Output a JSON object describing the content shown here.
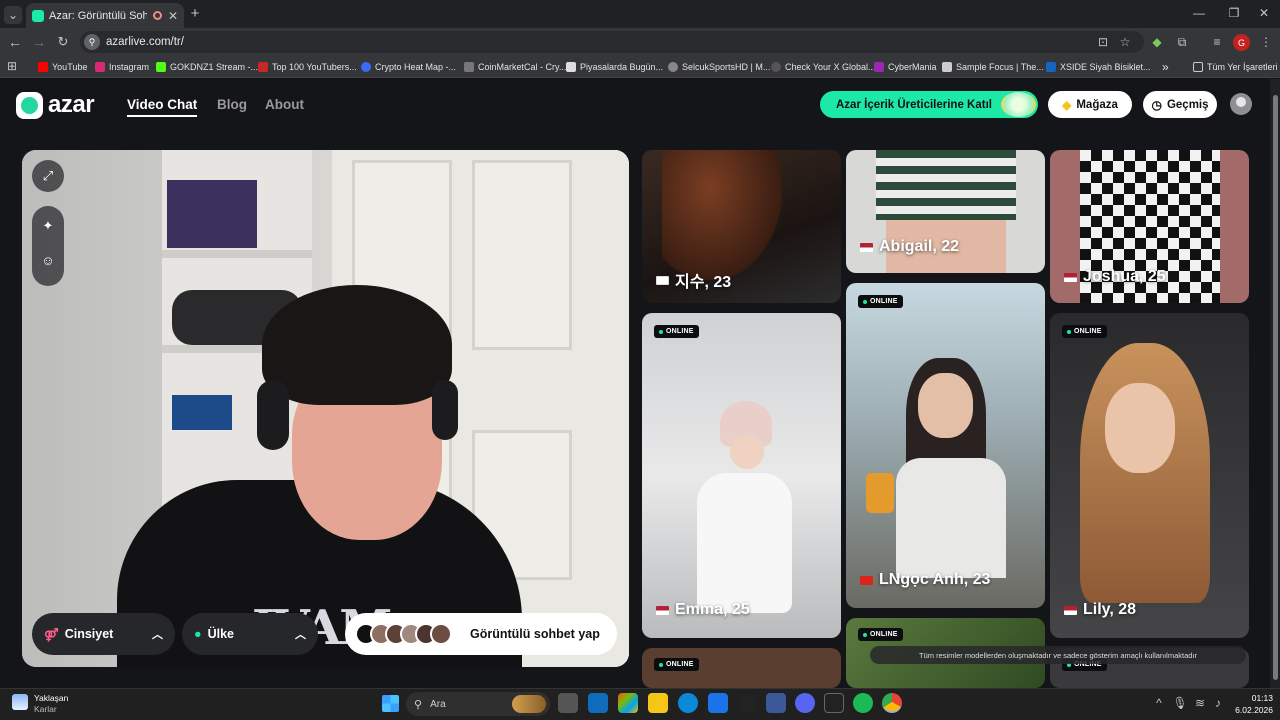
{
  "browser": {
    "tab_title": "Azar: Görüntülü Sohbet & V",
    "url": "azarlive.com/tr/",
    "profile_initial": "G",
    "bookmarks": [
      "YouTube",
      "Instagram",
      "GOKDNZ1 Stream -...",
      "Top 100 YouTubers...",
      "Crypto Heat Map -...",
      "CoinMarketCal - Cry...",
      "Piyasalarda Bugün...",
      "SelcukSportsHD | M...",
      "Check Your X Global...",
      "CyberMania",
      "Sample Focus | The...",
      "XSIDE Siyah Bisiklet..."
    ],
    "bookmarks_overflow": "»",
    "all_bookmarks": "Tüm Yer İşaretleri"
  },
  "site": {
    "logo": "azar",
    "nav": [
      "Video Chat",
      "Blog",
      "About"
    ],
    "creator_button": "Azar İçerik Üreticilerine Katıl",
    "store_button": "Mağaza",
    "history_button": "Geçmiş"
  },
  "video_controls": {
    "gender": "Cinsiyet",
    "country": "Ülke",
    "start_chat": "Görüntülü sohbet yap"
  },
  "cards": {
    "online_badge": "ONLINE",
    "profiles": [
      {
        "name": "지수, 23",
        "flag": "kr"
      },
      {
        "name": "Abigail, 22",
        "flag": "us"
      },
      {
        "name": "Joshua, 25",
        "flag": "us"
      },
      {
        "name": "Emma, 25",
        "flag": "us"
      },
      {
        "name": "LNgọc Anh, 23",
        "flag": "vn"
      },
      {
        "name": "Lily, 28",
        "flag": "us"
      }
    ],
    "notice": "Tüm resimler modellerden oluşmaktadır ve sadece gösterim amaçlı kullanılmaktadır"
  },
  "taskbar": {
    "weather_title": "Yaklaşan",
    "weather_sub": "Karlar",
    "search_placeholder": "Ara",
    "time": "01:13",
    "date": "6.02.2026"
  },
  "colors": {
    "accent": "#1de9a6",
    "background": "#141518"
  }
}
